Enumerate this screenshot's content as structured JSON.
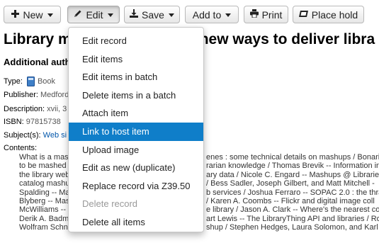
{
  "toolbar": {
    "new_label": "New",
    "edit_label": "Edit",
    "save_label": "Save",
    "addto_label": "Add to",
    "print_label": "Print",
    "placehold_label": "Place hold"
  },
  "record": {
    "title": "Library mashups : exploring new ways to deliver library data",
    "title_left": "Library m",
    "title_right": "new ways to deliver libra",
    "additional_authors_label": "Additional auth",
    "type_label": "Type:",
    "type_value": "Book",
    "publisher_label": "Publisher:",
    "publisher_value": "Medford",
    "description_label": "Description:",
    "description_value": "xvii, 3",
    "isbn_label": "ISBN:",
    "isbn_value": "97815738",
    "subjects_label": "Subject(s):",
    "subjects_value": "Web si",
    "contents_label": "Contents:",
    "contents_lines_left": [
      "What is a mash",
      "to be mashed",
      "the library web",
      "catalog mashu",
      "Spalding -- Ma",
      "Blyberg -- Mas",
      "McWilliams --",
      "Derik A. Badm",
      "Wolfram Schn"
    ],
    "contents_lines_right": [
      "enes : some technical details on mashups / Bonaria",
      "rarian knowledge / Thomas Brevik -- Information in",
      "ary data / Nicole C. Engard -- Mashups @ Libraries",
      "/ Bess Sadler, Joseph Gilbert, and Matt Mitchell -",
      "b services / Joshua Ferraro -- SOPAC 2.0 : the thra",
      "/ Karen A. Coombs -- Flickr and digital image coll",
      "e library / Jason A. Clark -- Where's the nearest co",
      "art Lewis -- The LibraryThing API and libraries / Ro",
      "shup / Stephen Hedges, Laura Solomon, and Karl J"
    ]
  },
  "edit_menu": {
    "items": [
      {
        "label": "Edit record",
        "state": "normal"
      },
      {
        "label": "Edit items",
        "state": "normal"
      },
      {
        "label": "Edit items in batch",
        "state": "normal"
      },
      {
        "label": "Delete items in a batch",
        "state": "normal"
      },
      {
        "label": "Attach item",
        "state": "normal"
      },
      {
        "label": "Link to host item",
        "state": "highlighted"
      },
      {
        "label": "Upload image",
        "state": "normal"
      },
      {
        "label": "Edit as new (duplicate)",
        "state": "normal"
      },
      {
        "label": "Replace record via Z39.50",
        "state": "normal"
      },
      {
        "label": "Delete record",
        "state": "disabled"
      },
      {
        "label": "Delete all items",
        "state": "normal"
      }
    ]
  },
  "colors": {
    "menu_highlight": "#0f7ec9",
    "link": "#0055aa",
    "book_icon": "#3f7fc7"
  },
  "icons": {
    "new": "plus-icon",
    "edit": "pencil-icon",
    "save": "download-icon",
    "print": "printer-icon",
    "place_hold": "bookmark-icon",
    "type": "book-icon"
  }
}
